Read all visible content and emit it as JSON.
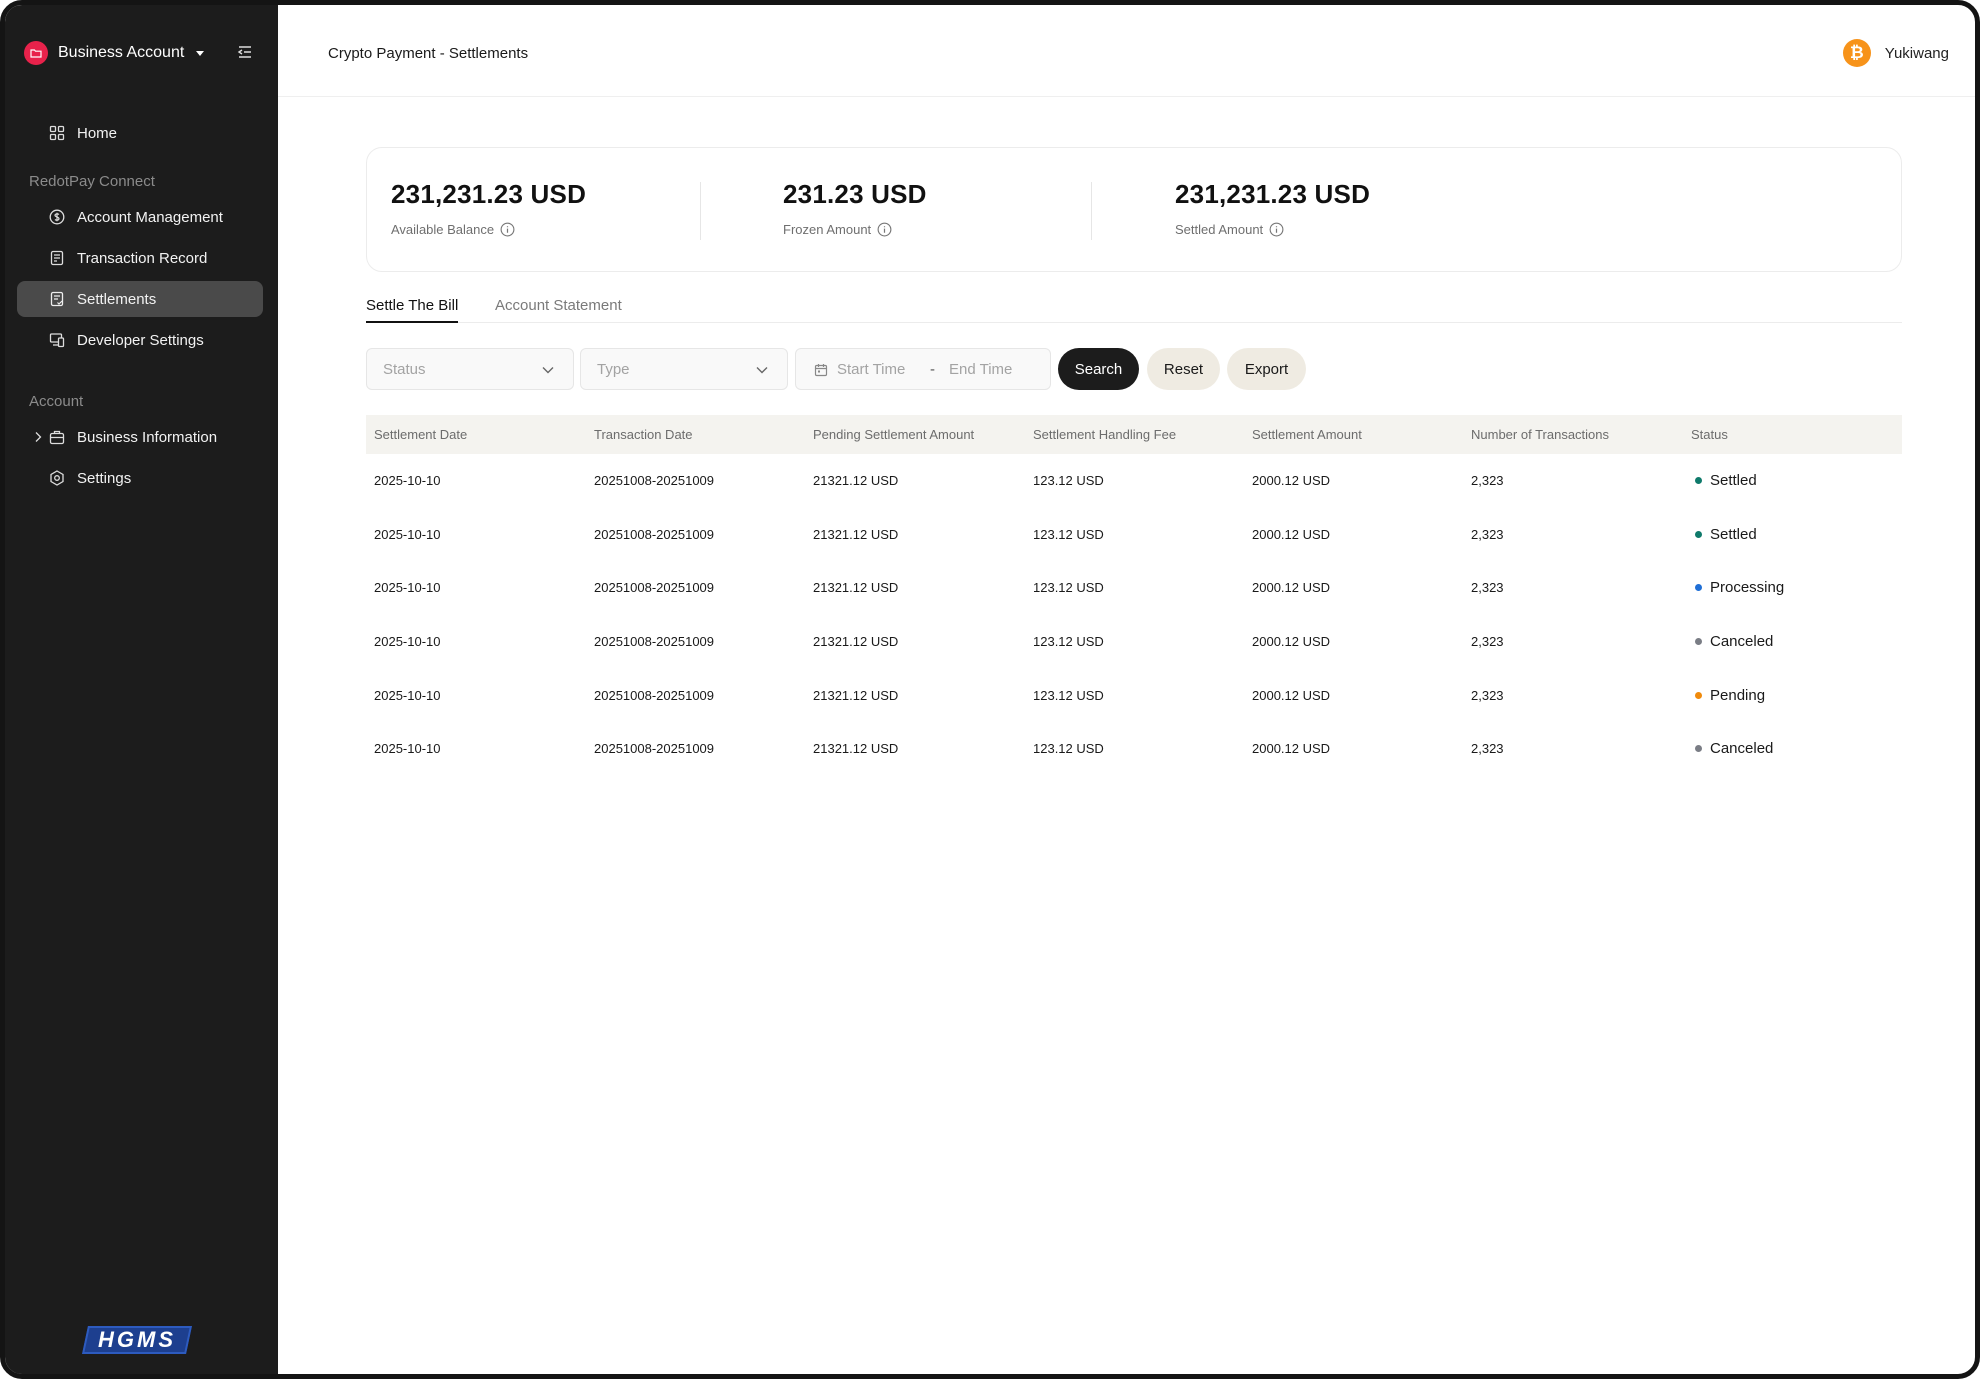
{
  "sidebar": {
    "account_name": "Business Account",
    "items": {
      "home": "Home",
      "group_connect": "RedotPay Connect",
      "account_management": "Account Management",
      "transaction_record": "Transaction Record",
      "settlements": "Settlements",
      "developer_settings": "Developer Settings",
      "group_account": "Account",
      "business_information": "Business Information",
      "settings": "Settings"
    },
    "logo_text": "HGMS",
    "brand_color": "#e8224b"
  },
  "header": {
    "title": "Crypto Payment - Settlements",
    "username": "Yukiwang",
    "avatar_glyph": "₿"
  },
  "balances": {
    "available": {
      "value": "231,231.23 USD",
      "label": "Available Balance"
    },
    "frozen": {
      "value": "231.23 USD",
      "label": "Frozen Amount"
    },
    "settled": {
      "value": "231,231.23 USD",
      "label": "Settled Amount"
    }
  },
  "tabs": {
    "settle": "Settle The Bill",
    "statement": "Account Statement"
  },
  "filters": {
    "status_placeholder": "Status",
    "type_placeholder": "Type",
    "start_placeholder": "Start Time",
    "separator": "-",
    "end_placeholder": "End Time",
    "search": "Search",
    "reset": "Reset",
    "export": "Export"
  },
  "table": {
    "headers": {
      "settlement_date": "Settlement Date",
      "transaction_date": "Transaction Date",
      "pending_amount": "Pending Settlement Amount",
      "handling_fee": "Settlement Handling Fee",
      "settlement_amount": "Settlement Amount",
      "num_transactions": "Number of Transactions",
      "status": "Status"
    },
    "rows": [
      {
        "settlement_date": "2025-10-10",
        "transaction_date": "20251008-20251009",
        "pending": "21321.12 USD",
        "fee": "123.12 USD",
        "amount": "2000.12 USD",
        "count": "2,323",
        "status": "Settled",
        "status_color": "#0f7a6b"
      },
      {
        "settlement_date": "2025-10-10",
        "transaction_date": "20251008-20251009",
        "pending": "21321.12 USD",
        "fee": "123.12 USD",
        "amount": "2000.12 USD",
        "count": "2,323",
        "status": "Settled",
        "status_color": "#0f7a6b"
      },
      {
        "settlement_date": "2025-10-10",
        "transaction_date": "20251008-20251009",
        "pending": "21321.12 USD",
        "fee": "123.12 USD",
        "amount": "2000.12 USD",
        "count": "2,323",
        "status": "Processing",
        "status_color": "#1f6fd6"
      },
      {
        "settlement_date": "2025-10-10",
        "transaction_date": "20251008-20251009",
        "pending": "21321.12 USD",
        "fee": "123.12 USD",
        "amount": "2000.12 USD",
        "count": "2,323",
        "status": "Canceled",
        "status_color": "#7a7d85"
      },
      {
        "settlement_date": "2025-10-10",
        "transaction_date": "20251008-20251009",
        "pending": "21321.12 USD",
        "fee": "123.12 USD",
        "amount": "2000.12 USD",
        "count": "2,323",
        "status": "Pending",
        "status_color": "#f08a0c"
      },
      {
        "settlement_date": "2025-10-10",
        "transaction_date": "20251008-20251009",
        "pending": "21321.12 USD",
        "fee": "123.12 USD",
        "amount": "2000.12 USD",
        "count": "2,323",
        "status": "Canceled",
        "status_color": "#7a7d85"
      }
    ]
  }
}
